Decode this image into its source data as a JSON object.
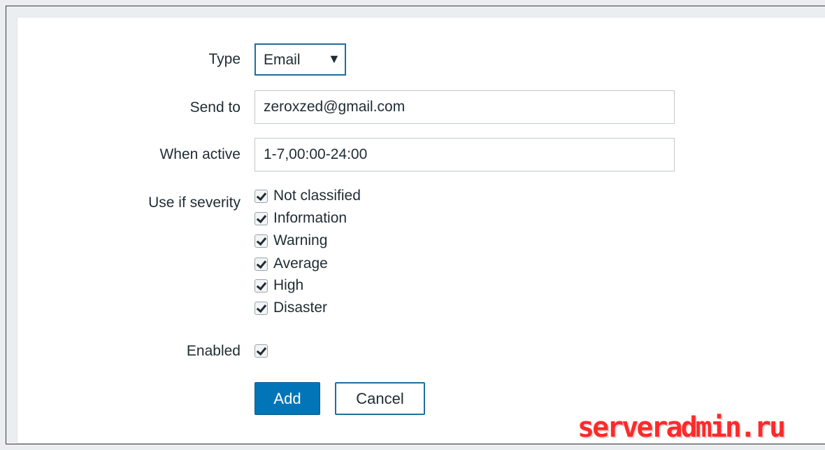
{
  "form": {
    "type": {
      "label": "Type",
      "value": "Email",
      "arrow": "▼"
    },
    "send_to": {
      "label": "Send to",
      "value": "zeroxzed@gmail.com"
    },
    "when_active": {
      "label": "When active",
      "value": "1-7,00:00-24:00"
    },
    "severity": {
      "label": "Use if severity",
      "options": [
        {
          "label": "Not classified",
          "checked": true
        },
        {
          "label": "Information",
          "checked": true
        },
        {
          "label": "Warning",
          "checked": true
        },
        {
          "label": "Average",
          "checked": true
        },
        {
          "label": "High",
          "checked": true
        },
        {
          "label": "Disaster",
          "checked": true
        }
      ]
    },
    "enabled": {
      "label": "Enabled",
      "checked": true
    },
    "buttons": {
      "add": "Add",
      "cancel": "Cancel"
    }
  },
  "watermark": "serveradmin.ru",
  "colors": {
    "primary": "#0275b8",
    "border_focus": "#1f6e9e",
    "watermark": "#ff2a2a"
  }
}
